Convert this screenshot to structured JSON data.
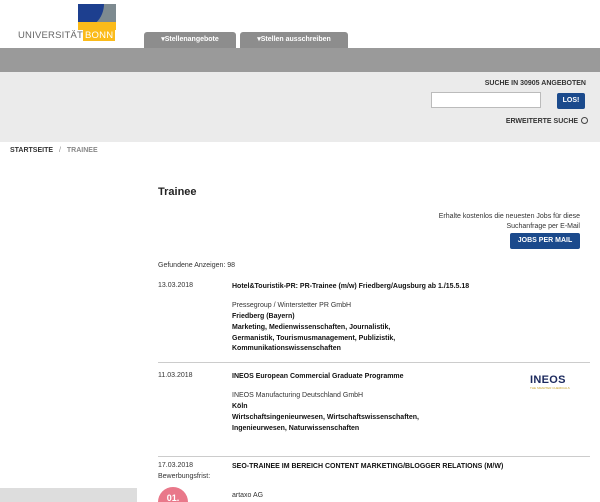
{
  "header": {
    "logo_text": "UNIVERSITÄT",
    "logo_city": "BONN",
    "tabs": [
      {
        "label": "▾Stellenangebote"
      },
      {
        "label": "▾Stellen ausschreiben"
      }
    ]
  },
  "search": {
    "title": "SUCHE IN 30905 ANGEBOTEN",
    "value": "",
    "placeholder": "",
    "button_label": "LOS!",
    "advanced_label": "ERWEITERTE SUCHE"
  },
  "breadcrumb": {
    "home": "STARTSEITE",
    "separator": "/",
    "current": "TRAINEE"
  },
  "main": {
    "title": "Trainee",
    "mail_info": "Erhalte kostenlos die neuesten Jobs für diese Suchanfrage per E-Mail",
    "mail_button": "JOBS PER MAIL",
    "count_label": "Gefundene Anzeigen: 98"
  },
  "jobs": [
    {
      "date": "13.03.2018",
      "title": "Hotel&Touristik-PR: PR-Trainee (m/w) Friedberg/Augsburg ab 1./15.5.18",
      "company": "Pressegroup / Winterstetter PR GmbH",
      "location": "Friedberg (Bayern)",
      "fields": "Marketing, Medienwissenschaften, Journalistik, Germanistik, Tourismusmanagement, Publizistik, Kommunikationswissenschaften"
    },
    {
      "date": "11.03.2018",
      "title": "INEOS European Commercial Graduate Programme",
      "company": "INEOS Manufacturing Deutschland GmbH",
      "location": "Köln",
      "fields": "Wirtschaftsingenieurwesen, Wirtschaftswissenschaften, Ingenieurwesen, Naturwissenschaften",
      "logo_word": "INEOS",
      "logo_sub": "THE SMARTER CHEMICALS"
    },
    {
      "date": "17.03.2018",
      "deadline_label": "Bewerbungsfrist:",
      "deadline_badge": "01.",
      "title": "SEO-TRAINEE IM BEREICH CONTENT MARKETING/BLOGGER RELATIONS (M/W)",
      "company": "artaxo AG"
    }
  ],
  "colors": {
    "accent_blue": "#1b4a8c",
    "tab_grey": "#8d8d8d",
    "band_grey": "#9a9a9a",
    "search_bg": "#ebebeb",
    "badge_pink": "#e9788a",
    "logo_yellow": "#fbbb1a"
  }
}
